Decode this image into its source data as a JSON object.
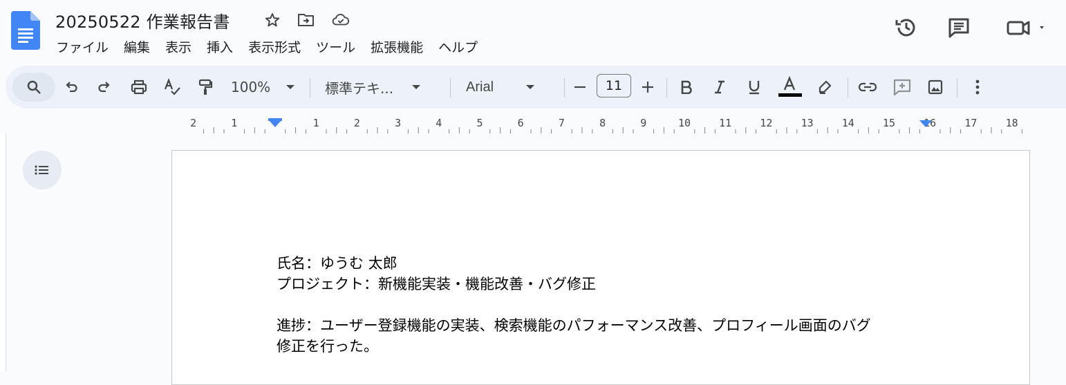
{
  "app": {
    "title": "20250522 作業報告書",
    "accent_color": "#4285f4"
  },
  "menu": [
    "ファイル",
    "編集",
    "表示",
    "挿入",
    "表示形式",
    "ツール",
    "拡張機能",
    "ヘルプ"
  ],
  "toolbar": {
    "zoom": "100%",
    "style": "標準テキ...",
    "font": "Arial",
    "font_size": "11",
    "icons": [
      "search-icon",
      "undo-icon",
      "redo-icon",
      "print-icon",
      "spellcheck-icon",
      "paint-format-icon",
      "bold-icon",
      "italic-icon",
      "underline-icon",
      "text-color-icon",
      "highlight-icon",
      "link-icon",
      "add-comment-icon",
      "image-icon",
      "more-icon"
    ]
  },
  "ruler": {
    "labels": [
      "2",
      "1",
      "1",
      "2",
      "3",
      "4",
      "5",
      "6",
      "7",
      "8",
      "9",
      "10",
      "11",
      "12",
      "13",
      "14",
      "15",
      "16",
      "17",
      "18"
    ]
  },
  "document": {
    "line1": "氏名：ゆうむ 太郎",
    "line2": "プロジェクト：新機能実装・機能改善・バグ修正",
    "line3": "進捗：ユーザー登録機能の実装、検索機能のパフォーマンス改善、プロフィール画面のバグ",
    "line4": "修正を行った。"
  }
}
